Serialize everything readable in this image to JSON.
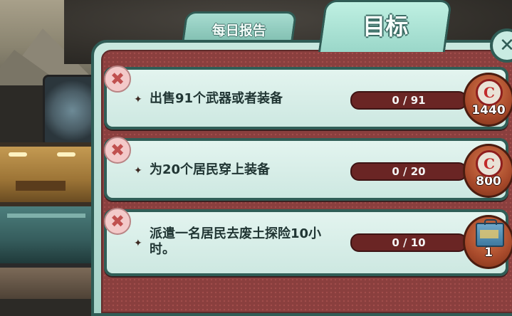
{
  "tabs": {
    "daily_report": "每日报告",
    "objectives": "目标"
  },
  "close_icon": "✕",
  "dismiss_icon": "✖",
  "objectives": [
    {
      "text": "出售91个武器或者装备",
      "progress": "0 / 91",
      "progress_fraction": 0,
      "reward_type": "bottle-cap-icon",
      "reward_symbol": "C",
      "reward_amount": "1440"
    },
    {
      "text": "为20个居民穿上装备",
      "progress": "0 / 20",
      "progress_fraction": 0,
      "reward_type": "bottle-cap-icon",
      "reward_symbol": "C",
      "reward_amount": "800"
    },
    {
      "text": "派遣一名居民去废土探险10小时。",
      "progress": "0 / 10",
      "progress_fraction": 0,
      "reward_type": "lunchbox-icon",
      "reward_amount": "1"
    }
  ],
  "colors": {
    "panel_teal": "#a6d3c8",
    "panel_border": "#2f5c55",
    "panel_maroon": "#8a3f3e",
    "progress_track": "#6a2524",
    "reward_copper": "#a84a2b"
  }
}
